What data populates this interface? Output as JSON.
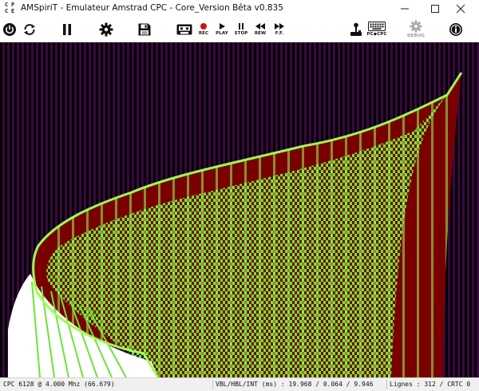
{
  "window": {
    "title": "AMSpiriT - Emulateur Amstrad CPC - Core_Version Bêta v0.835",
    "icon_letters": [
      "C",
      "P",
      "C",
      "E"
    ]
  },
  "toolbar": {
    "power": "power-icon",
    "reset": "reset-icon",
    "pause": "pause-icon",
    "settings": "gear-icon",
    "disk": "floppy-disk-icon",
    "tape": "cassette-icon",
    "rec_label": "REC",
    "play_label": "PLAY",
    "stop_label": "STOP",
    "rew_label": "REW",
    "ff_label": "F.F.",
    "joystick": "joystick-icon",
    "keyboard": "keyboard-icon",
    "keyboard_label": "PC◆CPC",
    "debug_label": "DEBUG",
    "info": "info-icon"
  },
  "screen": {
    "background": "#3a0840",
    "stripe_color": "#000000",
    "dark_red": "#7a0000",
    "green": "#6ee33a",
    "bright_green": "#9bff55",
    "white": "#ffffff"
  },
  "statusbar": {
    "machine": "CPC 6128 @ 4.000 Mhz (66.679)",
    "timing": "VBL/HBL/INT (ms) : 19.968 / 0.064 / 9.946",
    "lines": "Lignes : 312 / CRTC 0"
  }
}
